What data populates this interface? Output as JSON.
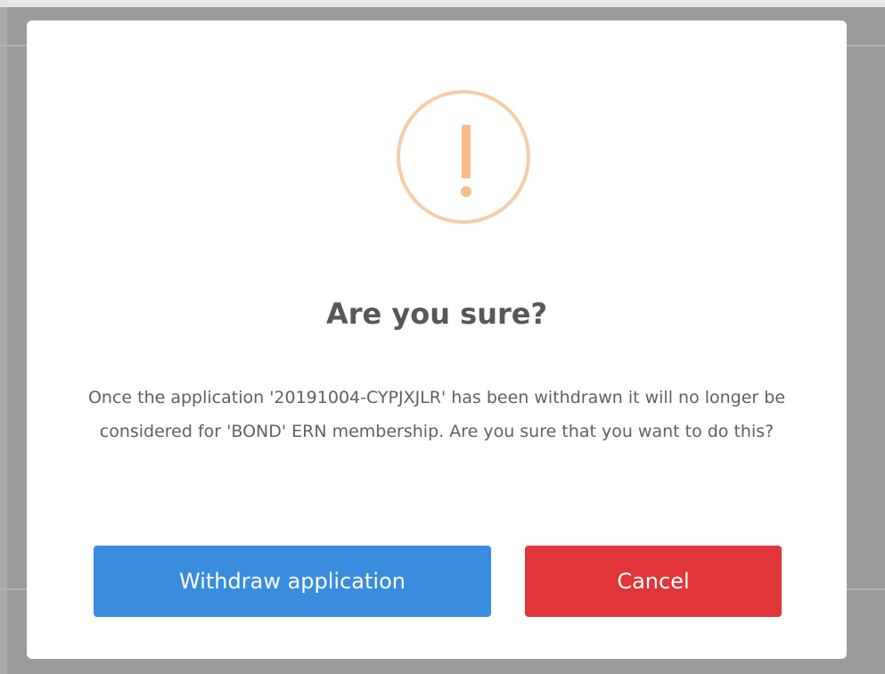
{
  "dialog": {
    "icon": "warning-exclamation-icon",
    "title": "Are you sure?",
    "message": "Once the application '20191004-CYPJXJLR' has been withdrawn it will no longer be considered for 'BOND' ERN membership. Are you sure that you want to do this?",
    "confirm_label": "Withdraw application",
    "cancel_label": "Cancel"
  },
  "colors": {
    "overlay": "#9b9b9b",
    "warning_icon": "#f8bb86",
    "confirm_button": "#3a8dde",
    "cancel_button": "#e0363a",
    "title_text": "#575757"
  }
}
